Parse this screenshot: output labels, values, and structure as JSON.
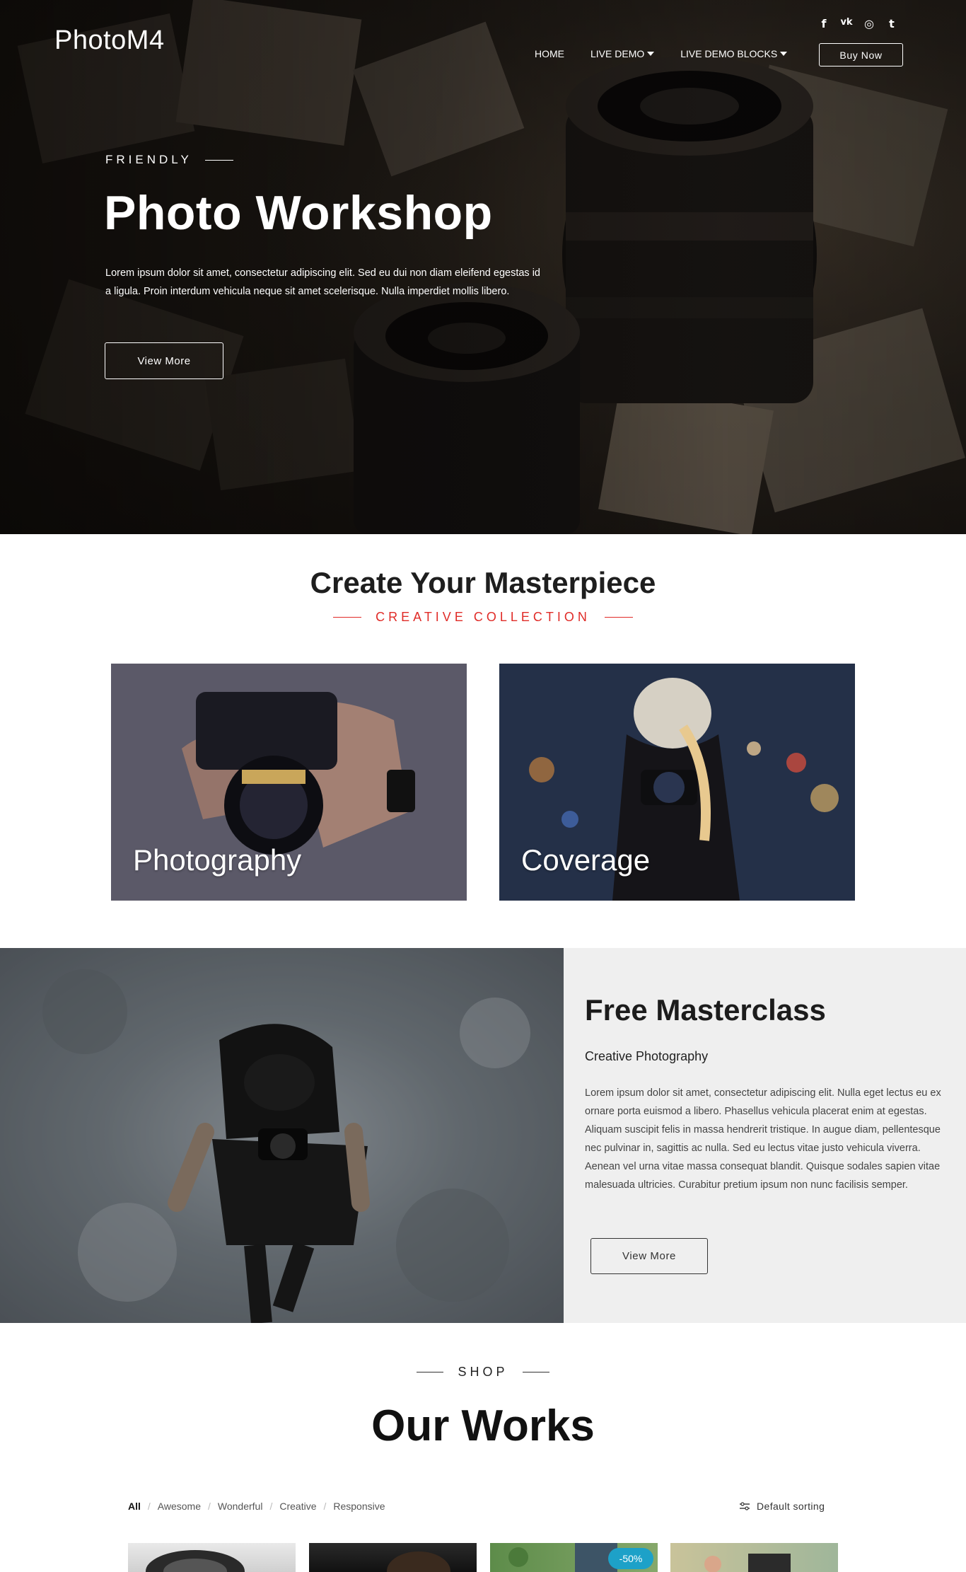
{
  "header": {
    "brand": "PhotoM4",
    "social": [
      {
        "icon": "facebook-icon",
        "glyph": "f"
      },
      {
        "icon": "vk-icon",
        "glyph": "vk"
      },
      {
        "icon": "instagram-icon",
        "glyph": "◎"
      },
      {
        "icon": "twitter-icon",
        "glyph": "t"
      }
    ],
    "nav": [
      {
        "label": "HOME",
        "dropdown": false
      },
      {
        "label": "LIVE DEMO",
        "dropdown": true
      },
      {
        "label": "LIVE DEMO BLOCKS",
        "dropdown": true
      }
    ],
    "buy_label": "Buy Now"
  },
  "hero": {
    "eyebrow": "FRIENDLY",
    "title": "Photo Workshop",
    "text": "Lorem ipsum dolor sit amet, consectetur adipiscing elit. Sed eu dui non diam eleifend egestas id a ligula. Proin interdum vehicula neque sit amet scelerisque. Nulla imperdiet mollis libero.",
    "button": "View More"
  },
  "collection": {
    "title": "Create Your Masterpiece",
    "subtitle": "CREATIVE COLLECTION",
    "cards": [
      {
        "label": "Photography"
      },
      {
        "label": "Coverage"
      }
    ]
  },
  "masterclass": {
    "title": "Free Masterclass",
    "subtitle": "Creative Photography",
    "text": "Lorem ipsum dolor sit amet, consectetur adipiscing elit. Nulla eget lectus eu ex ornare porta euismod a libero. Phasellus vehicula placerat enim at egestas. Aliquam suscipit felis in massa hendrerit tristique. In augue diam, pellentesque nec pulvinar in, sagittis ac nulla. Sed eu lectus vitae justo vehicula viverra. Aenean vel urna vitae massa consequat blandit. Quisque sodales sapien vitae malesuada ultricies. Curabitur pretium ipsum non nunc facilisis semper.",
    "button": "View More"
  },
  "shop": {
    "eyebrow": "SHOP",
    "title": "Our Works",
    "filters": [
      "All",
      "Awesome",
      "Wonderful",
      "Creative",
      "Responsive"
    ],
    "active_filter": "All",
    "sorting": "Default sorting",
    "sale_badge": "-50%"
  },
  "colors": {
    "accent": "#e02b27",
    "sale_badge": "#1da1c8",
    "panel_bg": "#efefef"
  }
}
